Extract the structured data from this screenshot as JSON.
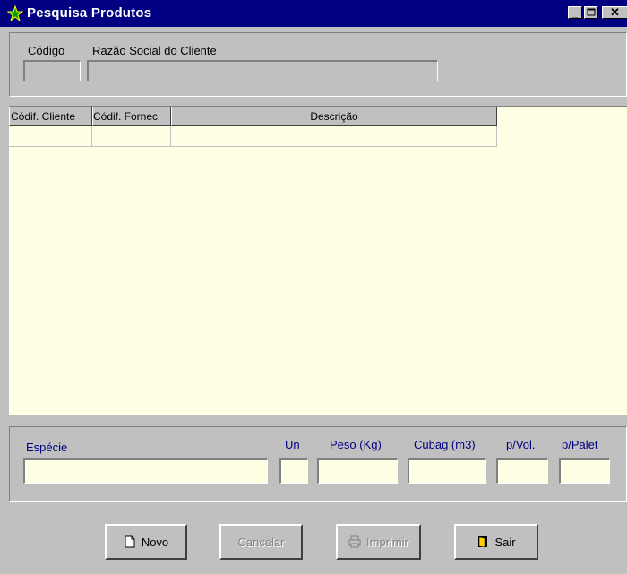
{
  "window": {
    "title": "Pesquisa Produtos"
  },
  "header": {
    "codigo_label": "Código",
    "razao_label": "Razão Social do Cliente",
    "codigo_value": "",
    "razao_value": ""
  },
  "grid": {
    "columns": [
      "Códif. Cliente",
      "Códif. Fornec",
      "Descrição"
    ],
    "rows": [
      [
        "",
        "",
        ""
      ]
    ]
  },
  "detail": {
    "especie_label": "Espécie",
    "un_label": "Un",
    "peso_label": "Peso (Kg)",
    "cubag_label": "Cubag (m3)",
    "pvol_label": "p/Vol.",
    "ppalet_label": "p/Palet"
  },
  "buttons": {
    "novo": "Novo",
    "cancelar": "Cancelar",
    "imprimir": "Imprimir",
    "sair": "Sair"
  },
  "colors": {
    "titlebar": "#000080",
    "field_bg": "#ffffe4",
    "label_blue": "#000080"
  }
}
